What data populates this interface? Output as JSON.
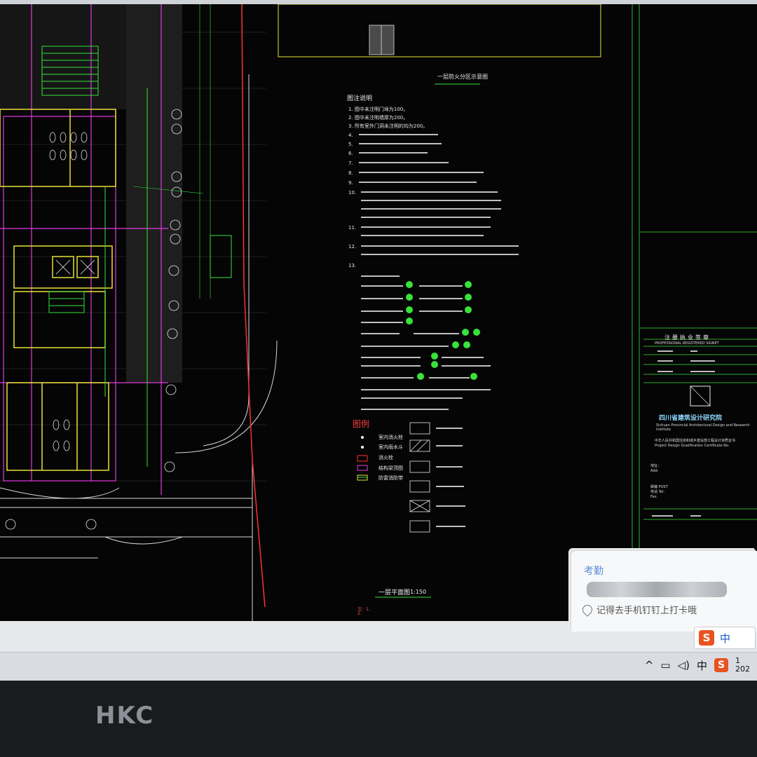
{
  "cad": {
    "sheet_title": "一层防火分区示意图",
    "notes_title": "图注说明",
    "notes": [
      "1.  图中未注明门垛为100。",
      "2.  图中未注明墙厚为200。",
      "3.  所有室外门洞未注明的均为200。",
      "4.",
      "5.",
      "6.",
      "7.",
      "8.",
      "9.",
      "10.",
      "11.",
      "12.",
      "13."
    ],
    "legend_title": "图例",
    "legend_items": [
      "室内消火栓",
      "室内雨水斗",
      "消火栓",
      "结构梁顶图",
      "防雷消防带"
    ],
    "plan_caption": "一层平面图",
    "plan_scale": "1:150",
    "redline_notes": [
      "注：1.",
      "2."
    ]
  },
  "title_block": {
    "registration_cn": "注册执业签章",
    "registration_en": "PROFESSIONAL REGISTERED SIGNET",
    "institute_name": "四川省建筑设计研究院",
    "institute_en": "Sichuan Provincial Architectural Design and Research Institute",
    "cert_line1": "中华人民共和国住房和城乡建设部工程设计资质证书",
    "cert_line2": "Project Design Qualification Certificate No.",
    "address_line1": "地址：",
    "address_line2": "Add:",
    "postcode_label": "邮编 POST",
    "tel_label": "电话 Tel:",
    "fax_label": "Fax:"
  },
  "toast": {
    "title": "考勤",
    "message": "记得去手机钉钉上打卡哦"
  },
  "ime": {
    "s_label": "S",
    "lang_label": "中"
  },
  "taskbar": {
    "tray_caret": "^",
    "tray_lang": "中",
    "tray_ime": "S",
    "clock_line1": "1",
    "clock_line2": "202"
  },
  "monitor": {
    "brand": "HKC"
  },
  "colors": {
    "cad_background": "#050505",
    "cad_yellow": "#e8e23a",
    "cad_green": "#38e23a",
    "cad_magenta": "#e23ae0",
    "cad_red": "#ff3030",
    "cad_white": "#e6e6e6",
    "institute_blue": "#8fd9ff",
    "toast_title": "#5b8dd9",
    "ime_orange": "#e8531f"
  }
}
